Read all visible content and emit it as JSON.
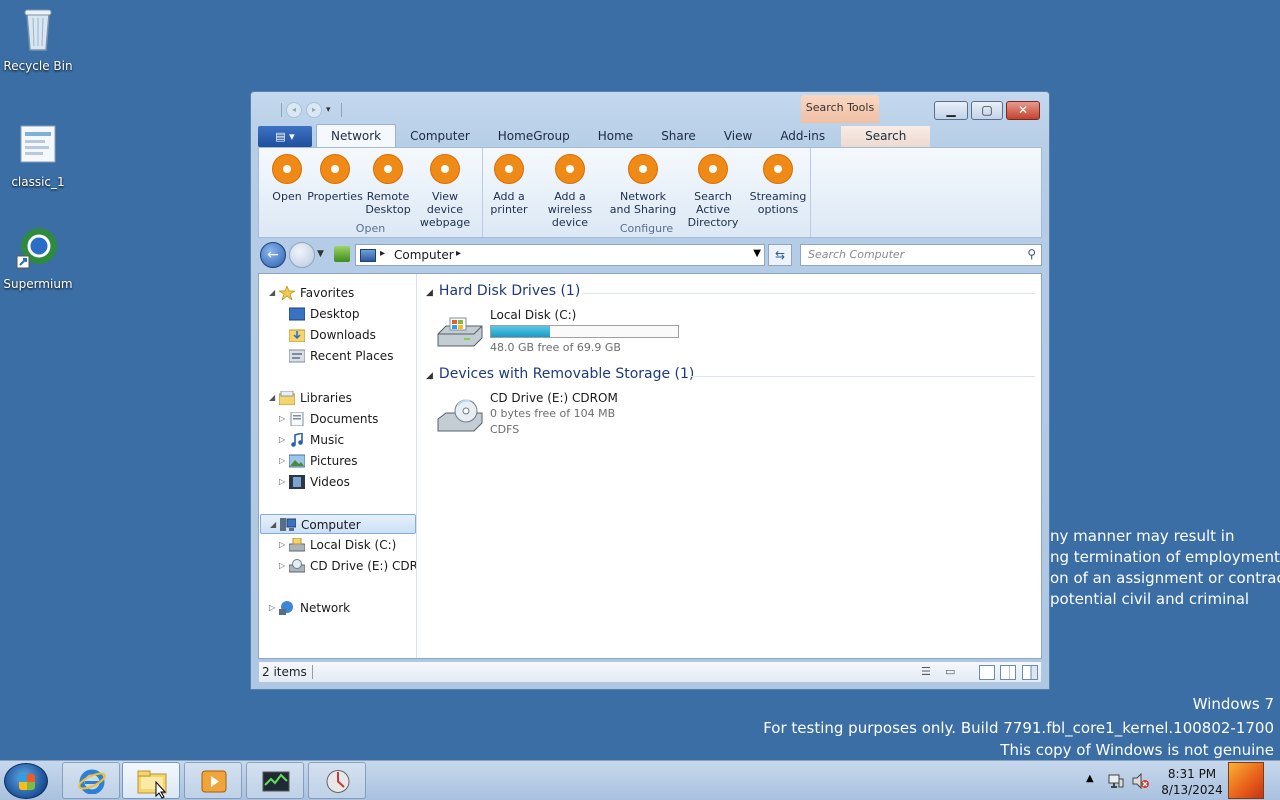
{
  "desktop": {
    "icons": [
      {
        "label": "Recycle Bin"
      },
      {
        "label": "classic_1"
      },
      {
        "label": "Supermium"
      }
    ],
    "background_text": [
      "ny manner may result in",
      "ng termination of employment",
      "on of an assignment or contract",
      "potential civil and criminal"
    ],
    "watermark": {
      "line1": "Windows 7",
      "line2": "For testing purposes only. Build 7791.fbl_core1_kernel.100802-1700",
      "line3": "This copy of Windows is not genuine"
    }
  },
  "window": {
    "context_tab": "Search Tools",
    "tabs": [
      "Network",
      "Computer",
      "HomeGroup",
      "Home",
      "Share",
      "View",
      "Add-ins",
      "Search"
    ],
    "active_tab": "Network",
    "ribbon": {
      "groups": [
        {
          "label": "Open",
          "buttons": [
            {
              "label": "Open"
            },
            {
              "label": "Properties"
            },
            {
              "label": "Remote Desktop"
            },
            {
              "label": "View device webpage"
            }
          ]
        },
        {
          "label": "Configure",
          "buttons": [
            {
              "label": "Add a printer"
            },
            {
              "label": "Add a wireless device"
            },
            {
              "label": "Network and Sharing"
            },
            {
              "label": "Search Active Directory"
            },
            {
              "label": "Streaming options"
            }
          ]
        }
      ]
    },
    "address": {
      "crumb": "Computer",
      "search_placeholder": "Search Computer"
    },
    "nav_pane": {
      "favorites": "Favorites",
      "desktop": "Desktop",
      "downloads": "Downloads",
      "recent": "Recent Places",
      "libraries": "Libraries",
      "documents": "Documents",
      "music": "Music",
      "pictures": "Pictures",
      "videos": "Videos",
      "computer": "Computer",
      "local_disk": "Local Disk (C:)",
      "cd_drive": "CD Drive (E:) CDROM",
      "network": "Network"
    },
    "groups": {
      "hdd_title": "Hard Disk Drives (1)",
      "removable_title": "Devices with Removable Storage (1)"
    },
    "drives": {
      "c": {
        "name": "Local Disk (C:)",
        "free_text": "48.0 GB free of 69.9 GB",
        "used_fraction": 0.313
      },
      "e": {
        "name": "CD Drive (E:) CDROM",
        "free_text": "0 bytes free of 104 MB",
        "fs": "CDFS"
      }
    },
    "status": {
      "items": "2 items"
    }
  },
  "taskbar": {
    "time": "8:31 PM",
    "date": "8/13/2024"
  },
  "colors": {
    "desktop": "#3a6ea5",
    "ribbon_icon": "#f08a17",
    "disk_fill": "#1a9bc3"
  }
}
